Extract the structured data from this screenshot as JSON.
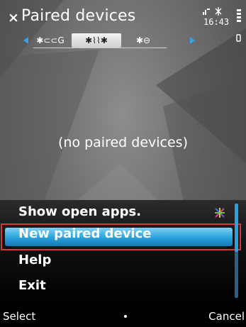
{
  "status": {
    "time": "16:43"
  },
  "header": {
    "title": "Paired devices"
  },
  "tabs": [
    {
      "label": "✱⊂⊂G",
      "icon": "bluetooth-headset-icon",
      "selected": false
    },
    {
      "label": "✱⌇⌇✱",
      "icon": "bluetooth-transfer-icon",
      "selected": true
    },
    {
      "label": "✱⊖",
      "icon": "bluetooth-device-icon",
      "selected": false
    }
  ],
  "content": {
    "empty_message": "(no paired devices)"
  },
  "menu": {
    "items": [
      {
        "label": "Show open apps."
      },
      {
        "label": "New paired device",
        "selected": true
      },
      {
        "label": "Help"
      },
      {
        "label": "Exit"
      }
    ]
  },
  "softkeys": {
    "left": "Select",
    "right": "Cancel"
  },
  "colors": {
    "highlight": "#28a2dd",
    "annotation_box": "#d23a3a"
  }
}
